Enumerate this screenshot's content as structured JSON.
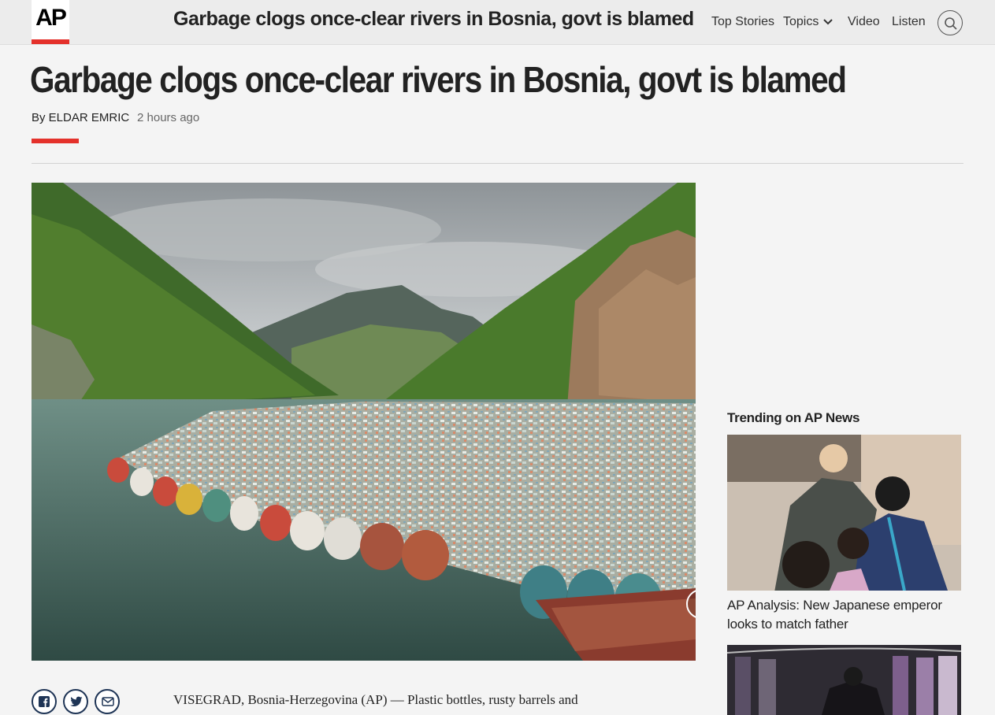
{
  "header": {
    "logo_text": "AP",
    "title": "Garbage clogs once-clear rivers in Bosnia, govt is blamed",
    "nav": {
      "top_stories": "Top Stories",
      "topics": "Topics",
      "video": "Video",
      "listen": "Listen"
    },
    "icons": {
      "search": "search-icon",
      "topics_dropdown": "chevron-down-icon"
    }
  },
  "article": {
    "headline": "Garbage clogs once-clear rivers in Bosnia, govt is blamed",
    "byline": "By ELDAR EMRIC",
    "timestamp": "2 hours ago",
    "lead": "VISEGRAD, Bosnia-Herzegovina (AP) — Plastic bottles, rusty barrels and",
    "share": {
      "icons": [
        "facebook-icon",
        "twitter-icon",
        "email-icon"
      ]
    },
    "gallery_next_icon": "chevron-right-icon"
  },
  "sidebar": {
    "trending_title": "Trending on AP News",
    "items": [
      {
        "caption": "AP Analysis: New Japanese emperor looks to match father"
      },
      {
        "caption": ""
      }
    ]
  },
  "colors": {
    "brand_red": "#e4312b",
    "topbar_bg": "#ececec",
    "page_bg": "#f4f4f4",
    "share_blue": "#1f3556"
  }
}
